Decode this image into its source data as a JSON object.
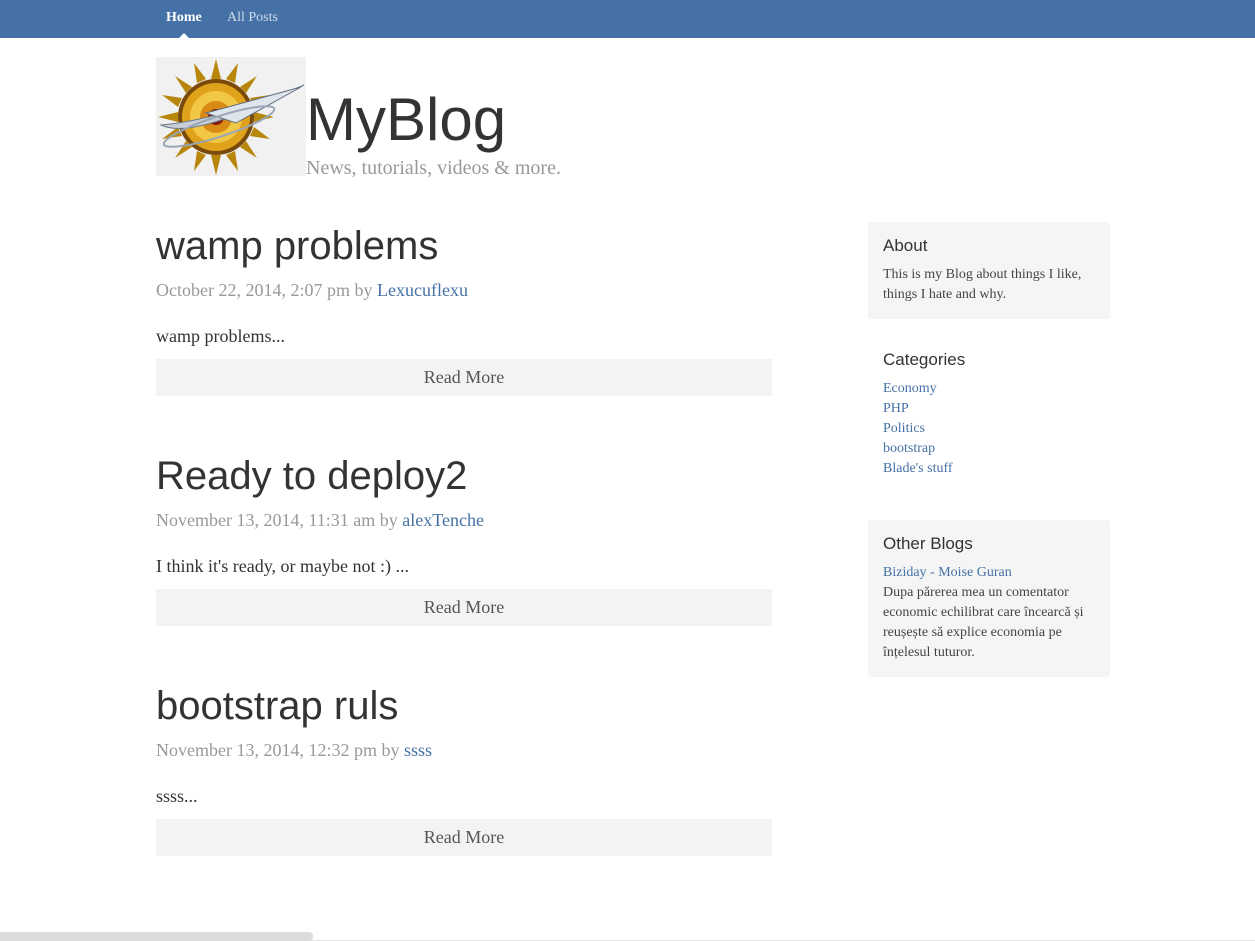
{
  "nav": {
    "items": [
      {
        "label": "Home"
      },
      {
        "label": "All Posts"
      }
    ]
  },
  "header": {
    "title": "MyBlog",
    "description": "News, tutorials, videos & more.",
    "logo_icon": "sun-logo-icon"
  },
  "posts": [
    {
      "title": "wamp problems",
      "date": "October 22, 2014, 2:07 pm by ",
      "author": "Lexucuflexu",
      "excerpt": "wamp problems...",
      "read_more": "Read More"
    },
    {
      "title": "Ready to deploy2",
      "date": "November 13, 2014, 11:31 am by ",
      "author": "alexTenche",
      "excerpt": "I think it's ready, or maybe not :) ...",
      "read_more": "Read More"
    },
    {
      "title": "bootstrap ruls",
      "date": "November 13, 2014, 12:32 pm by ",
      "author": "ssss",
      "excerpt": "ssss...",
      "read_more": "Read More"
    }
  ],
  "sidebar": {
    "about": {
      "heading": "About",
      "text": "This is my Blog about things I like, things I hate and why."
    },
    "categories": {
      "heading": "Categories",
      "items": [
        "Economy",
        "PHP",
        "Politics",
        "bootstrap",
        "Blade's stuff"
      ]
    },
    "other_blogs": {
      "heading": "Other Blogs",
      "link": "Biziday - Moise Guran",
      "text": "Dupa părerea mea un comentator economic echilibrat care încearcă și reușește să explice economia pe înțelesul tuturor."
    }
  },
  "colors": {
    "navbar": "#4571a6",
    "link": "#4571a6",
    "muted": "#999999",
    "panel": "#f5f5f5",
    "button": "#f3f3f3"
  }
}
